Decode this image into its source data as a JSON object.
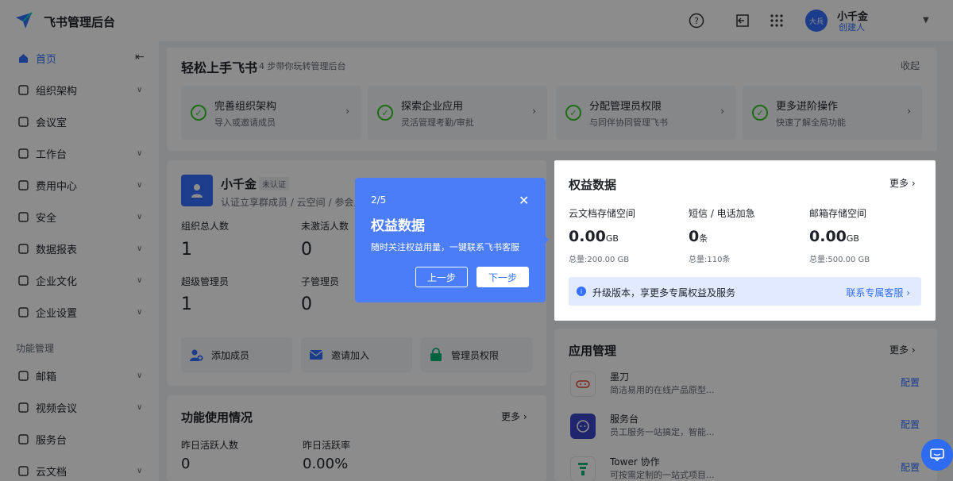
{
  "header": {
    "app_title": "飞书管理后台",
    "user_name": "小千金",
    "user_role": "创建人",
    "avatar_text": "大兵"
  },
  "sidebar": {
    "items": [
      {
        "label": "首页",
        "icon": "home-icon",
        "active": true,
        "chevron": false
      },
      {
        "label": "组织架构",
        "icon": "org-icon",
        "chevron": true
      },
      {
        "label": "会议室",
        "icon": "meeting-room-icon",
        "chevron": false
      },
      {
        "label": "工作台",
        "icon": "workbench-icon",
        "chevron": true
      },
      {
        "label": "费用中心",
        "icon": "dollar-icon",
        "chevron": true
      },
      {
        "label": "安全",
        "icon": "shield-icon",
        "chevron": true
      },
      {
        "label": "数据报表",
        "icon": "bar-chart-icon",
        "chevron": true
      },
      {
        "label": "企业文化",
        "icon": "culture-icon",
        "chevron": true
      },
      {
        "label": "企业设置",
        "icon": "settings-icon",
        "chevron": true
      }
    ],
    "section_label": "功能管理",
    "items2": [
      {
        "label": "邮箱",
        "icon": "mail-icon",
        "chevron": true
      },
      {
        "label": "视频会议",
        "icon": "video-icon",
        "chevron": true
      },
      {
        "label": "服务台",
        "icon": "headset-icon",
        "chevron": false
      },
      {
        "label": "云文档",
        "icon": "doc-icon",
        "chevron": true
      }
    ]
  },
  "guide": {
    "title": "轻松上手飞书",
    "subtitle": "4 步带你玩转管理后台",
    "collapse_label": "收起",
    "steps": [
      {
        "title": "完善组织架构",
        "sub": "导入或邀请成员"
      },
      {
        "title": "探索企业应用",
        "sub": "灵活管理考勤/审批"
      },
      {
        "title": "分配管理员权限",
        "sub": "与同伴协同管理飞书"
      },
      {
        "title": "更多进阶操作",
        "sub": "快速了解全局功能"
      }
    ]
  },
  "org": {
    "name": "小千金",
    "badge": "未认证",
    "desc": "认证立享群成员 / 云空间 / 参会人",
    "stats": [
      {
        "label": "组织总人数",
        "value": "1"
      },
      {
        "label": "未激活人数",
        "value": "0"
      },
      {
        "label": "超级管理员",
        "value": "1"
      },
      {
        "label": "子管理员",
        "value": "0"
      }
    ],
    "actions": [
      "添加成员",
      "邀请加入",
      "管理员权限"
    ]
  },
  "usage": {
    "title": "功能使用情况",
    "more": "更多",
    "stats": [
      {
        "label": "昨日活跃人数",
        "value": "0"
      },
      {
        "label": "昨日活跃率",
        "value": "0.00%"
      }
    ]
  },
  "benefits": {
    "title": "权益数据",
    "more": "更多",
    "metrics": [
      {
        "label": "云文档存储空间",
        "value": "0.00",
        "unit": "GB",
        "total": "总量:200.00 GB"
      },
      {
        "label": "短信 / 电话加急",
        "value": "0",
        "unit": "条",
        "total": "总量:110条"
      },
      {
        "label": "邮箱存储空间",
        "value": "0.00",
        "unit": "GB",
        "total": "总量:500.00 GB"
      }
    ],
    "upgrade_text": "升级版本，享更多专属权益及服务",
    "upgrade_link": "联系专属客服"
  },
  "apps": {
    "title": "应用管理",
    "more": "更多",
    "config_label": "配置",
    "items": [
      {
        "name": "墨刀",
        "desc": "简洁易用的在线产品原型..."
      },
      {
        "name": "服务台",
        "desc": "员工服务一站搞定，智能..."
      },
      {
        "name": "Tower 协作",
        "desc": "可按需定制的一站式项目..."
      }
    ]
  },
  "tour": {
    "step": "2/5",
    "title": "权益数据",
    "desc": "随时关注权益用量，一键联系飞书客服",
    "prev": "上一步",
    "next": "下一步"
  }
}
